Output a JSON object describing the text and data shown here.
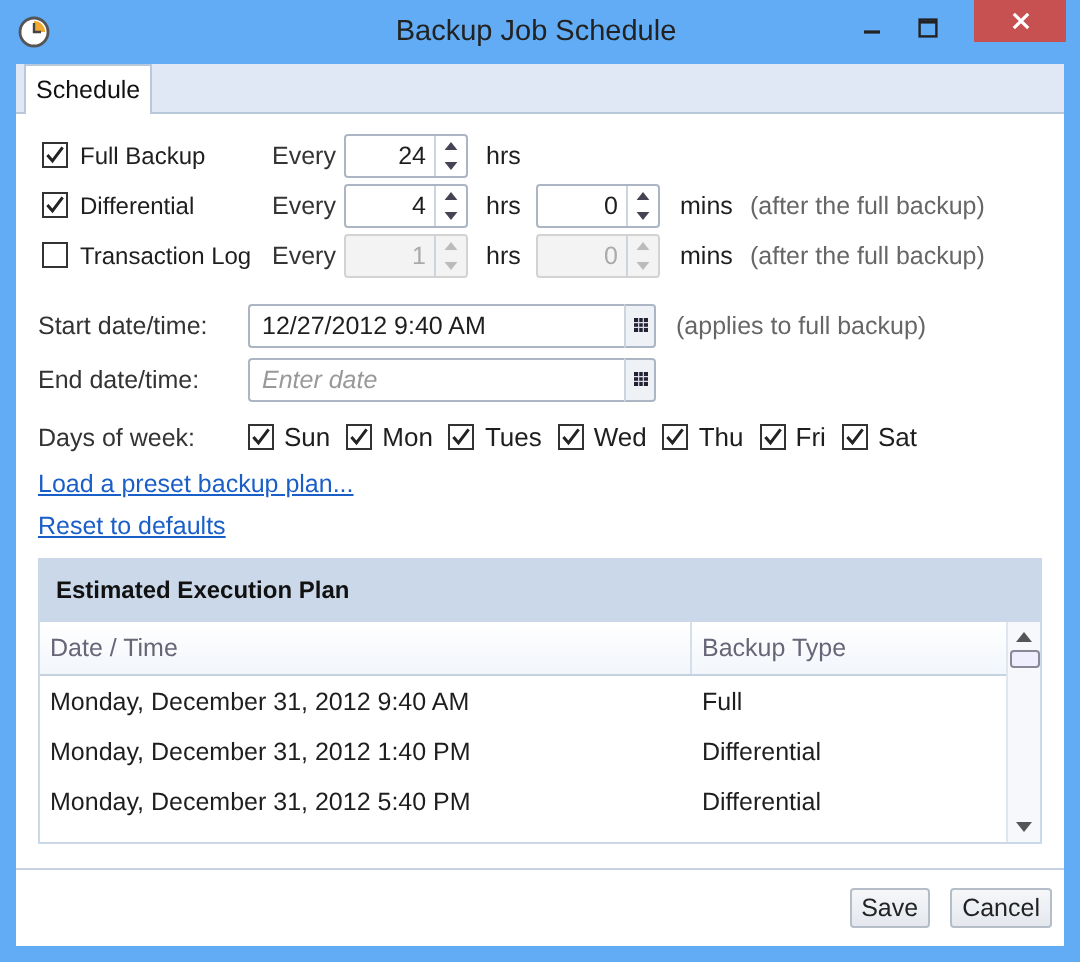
{
  "window": {
    "title": "Backup Job Schedule"
  },
  "tabs": [
    {
      "label": "Schedule",
      "selected": true
    }
  ],
  "backup_types": [
    {
      "label": "Full Backup",
      "checked": true,
      "disabled": false,
      "every": "Every",
      "hours": "24",
      "hours_unit": "hrs"
    },
    {
      "label": "Differential",
      "checked": true,
      "disabled": false,
      "every": "Every",
      "hours": "4",
      "hours_unit": "hrs",
      "minutes": "0",
      "minutes_unit": "mins",
      "note": "(after the full backup)"
    },
    {
      "label": "Transaction Log",
      "checked": false,
      "disabled": true,
      "every": "Every",
      "hours": "1",
      "hours_unit": "hrs",
      "minutes": "0",
      "minutes_unit": "mins",
      "note": "(after the full backup)"
    }
  ],
  "start": {
    "label": "Start date/time:",
    "value": "12/27/2012 9:40 AM",
    "note": "(applies to full backup)"
  },
  "end": {
    "label": "End date/time:",
    "placeholder": "Enter date"
  },
  "days": {
    "label": "Days of week:",
    "items": [
      {
        "label": "Sun",
        "checked": true
      },
      {
        "label": "Mon",
        "checked": true
      },
      {
        "label": "Tues",
        "checked": true
      },
      {
        "label": "Wed",
        "checked": true
      },
      {
        "label": "Thu",
        "checked": true
      },
      {
        "label": "Fri",
        "checked": true
      },
      {
        "label": "Sat",
        "checked": true
      }
    ]
  },
  "links": [
    "Load a preset backup plan...",
    "Reset to defaults"
  ],
  "plan": {
    "title": "Estimated Execution Plan",
    "columns": [
      "Date / Time",
      "Backup Type"
    ],
    "rows": [
      [
        "Monday, December 31, 2012 9:40 AM",
        "Full"
      ],
      [
        "Monday, December 31, 2012 1:40 PM",
        "Differential"
      ],
      [
        "Monday, December 31, 2012 5:40 PM",
        "Differential"
      ]
    ]
  },
  "buttons": [
    "Save",
    "Cancel"
  ]
}
